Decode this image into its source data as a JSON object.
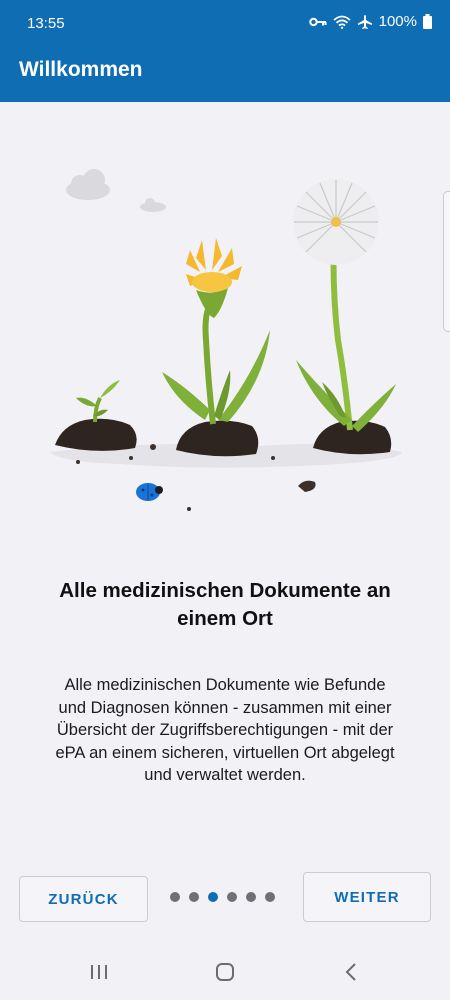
{
  "status": {
    "time": "13:55",
    "battery": "100%",
    "icons": [
      "key-icon",
      "wifi-icon",
      "airplane-icon",
      "battery-icon"
    ]
  },
  "app_bar": {
    "title": "Willkommen"
  },
  "content": {
    "heading_line1": "Alle medizinischen Dokumente an",
    "heading_line2": "einem Ort",
    "body_lines": [
      "Alle medizinischen Dokumente wie Befunde",
      "und Diagnosen können - zusammen mit einer",
      "Übersicht der Zugriffsberechtigungen - mit der",
      "ePA an einem sicheren, virtuellen Ort abgelegt",
      "und verwaltet werden."
    ]
  },
  "navigation": {
    "back_label": "ZURÜCK",
    "next_label": "WEITER",
    "page_count": 6,
    "current_page": 3
  },
  "system_nav": {
    "icons": [
      "recents-icon",
      "home-icon",
      "back-icon"
    ]
  },
  "colors": {
    "primary": "#0f6db3",
    "background": "#f2f1f6",
    "dot_inactive": "#6f6f75"
  }
}
